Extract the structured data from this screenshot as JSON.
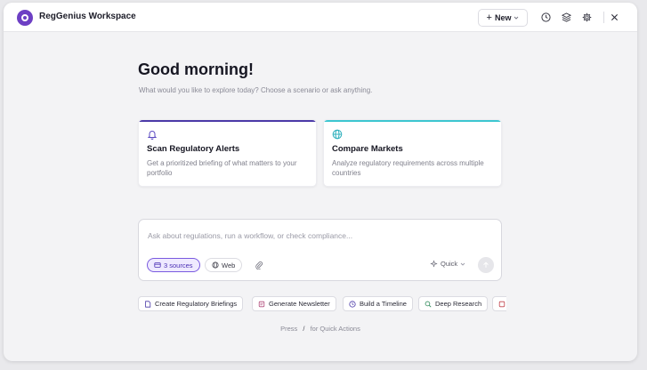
{
  "app": {
    "title": "RegGenius Workspace",
    "accent": "#6d3fc4"
  },
  "header": {
    "new_label": "New",
    "icons": [
      "history-icon",
      "layers-icon",
      "settings-icon",
      "close-icon"
    ]
  },
  "hero": {
    "greeting": "Good morning!",
    "subtitle": "What would you like to explore today? Choose a scenario or ask anything."
  },
  "cards": [
    {
      "title": "Scan Regulatory Alerts",
      "description": "Get a prioritized briefing of what matters to your portfolio",
      "icon": "bell-icon",
      "accent": "#4b3aa8"
    },
    {
      "title": "Compare Markets",
      "description": "Analyze regulatory requirements across multiple countries",
      "icon": "globe-icon",
      "accent": "#3cc6d0"
    }
  ],
  "composer": {
    "placeholder": "Ask about regulations, run a workflow, or check compliance...",
    "value": "",
    "sources_label": "3 sources",
    "web_label": "Web",
    "mode_label": "Quick"
  },
  "quick_actions": [
    {
      "label": "Create Regulatory Briefings",
      "icon": "document-icon",
      "color": "#4b3aa8"
    },
    {
      "label": "Generate Newsletter",
      "icon": "newsletter-icon",
      "color": "#b04a7a"
    },
    {
      "label": "Build a Timeline",
      "icon": "clock-icon",
      "color": "#4b3aa8"
    },
    {
      "label": "Deep Research",
      "icon": "search-icon",
      "color": "#2f8a5a"
    }
  ],
  "hint": {
    "prefix": "Press",
    "key": "/",
    "suffix": "for Quick Actions"
  }
}
